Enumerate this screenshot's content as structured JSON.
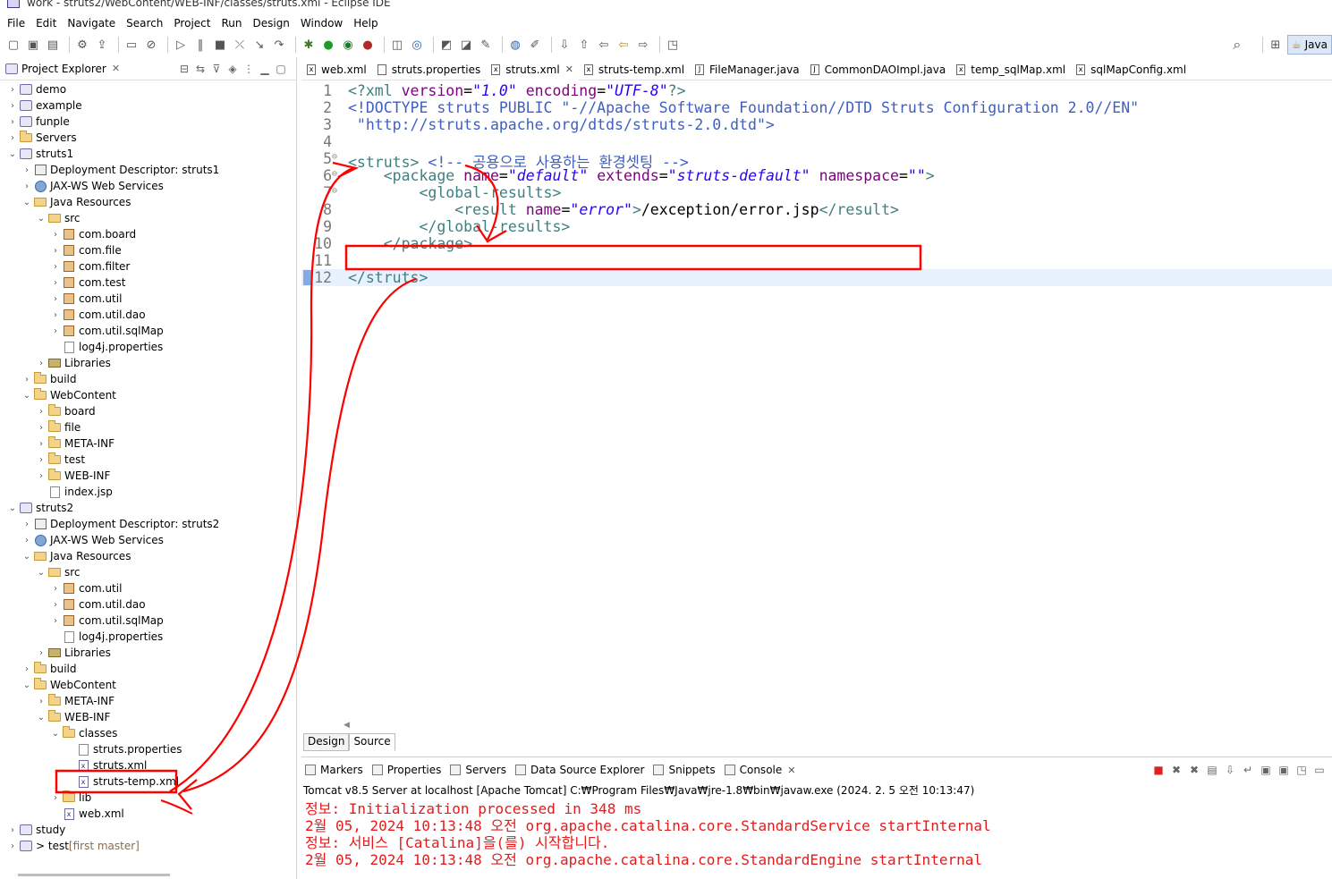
{
  "window": {
    "title": "work - struts2/WebContent/WEB-INF/classes/struts.xml - Eclipse IDE"
  },
  "menu": [
    "File",
    "Edit",
    "Navigate",
    "Search",
    "Project",
    "Run",
    "Design",
    "Window",
    "Help"
  ],
  "toolbar": {
    "perspective_label": "Java"
  },
  "explorer": {
    "title": "Project Explorer",
    "tree": [
      {
        "label": "demo",
        "depth": 0,
        "twisty": "›",
        "icon": "project"
      },
      {
        "label": "example",
        "depth": 0,
        "twisty": "›",
        "icon": "project"
      },
      {
        "label": "funple",
        "depth": 0,
        "twisty": "›",
        "icon": "project"
      },
      {
        "label": "Servers",
        "depth": 0,
        "twisty": "›",
        "icon": "folder"
      },
      {
        "label": "struts1",
        "depth": 0,
        "twisty": "⌄",
        "icon": "project"
      },
      {
        "label": "Deployment Descriptor: struts1",
        "depth": 1,
        "twisty": "›",
        "icon": "desc"
      },
      {
        "label": "JAX-WS Web Services",
        "depth": 1,
        "twisty": "›",
        "icon": "globe"
      },
      {
        "label": "Java Resources",
        "depth": 1,
        "twisty": "⌄",
        "icon": "src"
      },
      {
        "label": "src",
        "depth": 2,
        "twisty": "⌄",
        "icon": "src"
      },
      {
        "label": "com.board",
        "depth": 3,
        "twisty": "›",
        "icon": "package"
      },
      {
        "label": "com.file",
        "depth": 3,
        "twisty": "›",
        "icon": "package"
      },
      {
        "label": "com.filter",
        "depth": 3,
        "twisty": "›",
        "icon": "package"
      },
      {
        "label": "com.test",
        "depth": 3,
        "twisty": "›",
        "icon": "package"
      },
      {
        "label": "com.util",
        "depth": 3,
        "twisty": "›",
        "icon": "package"
      },
      {
        "label": "com.util.dao",
        "depth": 3,
        "twisty": "›",
        "icon": "package"
      },
      {
        "label": "com.util.sqlMap",
        "depth": 3,
        "twisty": "›",
        "icon": "package"
      },
      {
        "label": "log4j.properties",
        "depth": 3,
        "twisty": "",
        "icon": "file"
      },
      {
        "label": "Libraries",
        "depth": 2,
        "twisty": "›",
        "icon": "lib"
      },
      {
        "label": "build",
        "depth": 1,
        "twisty": "›",
        "icon": "folder"
      },
      {
        "label": "WebContent",
        "depth": 1,
        "twisty": "⌄",
        "icon": "folder"
      },
      {
        "label": "board",
        "depth": 2,
        "twisty": "›",
        "icon": "folder"
      },
      {
        "label": "file",
        "depth": 2,
        "twisty": "›",
        "icon": "folder"
      },
      {
        "label": "META-INF",
        "depth": 2,
        "twisty": "›",
        "icon": "folder"
      },
      {
        "label": "test",
        "depth": 2,
        "twisty": "›",
        "icon": "folder"
      },
      {
        "label": "WEB-INF",
        "depth": 2,
        "twisty": "›",
        "icon": "folder"
      },
      {
        "label": "index.jsp",
        "depth": 2,
        "twisty": "",
        "icon": "jsp"
      },
      {
        "label": "struts2",
        "depth": 0,
        "twisty": "⌄",
        "icon": "project"
      },
      {
        "label": "Deployment Descriptor: struts2",
        "depth": 1,
        "twisty": "›",
        "icon": "desc"
      },
      {
        "label": "JAX-WS Web Services",
        "depth": 1,
        "twisty": "›",
        "icon": "globe"
      },
      {
        "label": "Java Resources",
        "depth": 1,
        "twisty": "⌄",
        "icon": "src"
      },
      {
        "label": "src",
        "depth": 2,
        "twisty": "⌄",
        "icon": "src"
      },
      {
        "label": "com.util",
        "depth": 3,
        "twisty": "›",
        "icon": "package"
      },
      {
        "label": "com.util.dao",
        "depth": 3,
        "twisty": "›",
        "icon": "package"
      },
      {
        "label": "com.util.sqlMap",
        "depth": 3,
        "twisty": "›",
        "icon": "package"
      },
      {
        "label": "log4j.properties",
        "depth": 3,
        "twisty": "",
        "icon": "file"
      },
      {
        "label": "Libraries",
        "depth": 2,
        "twisty": "›",
        "icon": "lib"
      },
      {
        "label": "build",
        "depth": 1,
        "twisty": "›",
        "icon": "folder"
      },
      {
        "label": "WebContent",
        "depth": 1,
        "twisty": "⌄",
        "icon": "folder"
      },
      {
        "label": "META-INF",
        "depth": 2,
        "twisty": "›",
        "icon": "folder"
      },
      {
        "label": "WEB-INF",
        "depth": 2,
        "twisty": "⌄",
        "icon": "folder"
      },
      {
        "label": "classes",
        "depth": 3,
        "twisty": "⌄",
        "icon": "folder"
      },
      {
        "label": "struts.properties",
        "depth": 4,
        "twisty": "",
        "icon": "file"
      },
      {
        "label": "struts.xml",
        "depth": 4,
        "twisty": "",
        "icon": "xml"
      },
      {
        "label": "struts-temp.xml",
        "depth": 4,
        "twisty": "",
        "icon": "xml"
      },
      {
        "label": "lib",
        "depth": 3,
        "twisty": "›",
        "icon": "folder"
      },
      {
        "label": "web.xml",
        "depth": 3,
        "twisty": "",
        "icon": "xml"
      },
      {
        "label": "study",
        "depth": 0,
        "twisty": "›",
        "icon": "project"
      },
      {
        "label": "> test",
        "suffix": " [first master]",
        "depth": 0,
        "twisty": "›",
        "icon": "project"
      }
    ]
  },
  "editor_tabs": [
    {
      "label": "web.xml",
      "icon": "x"
    },
    {
      "label": "struts.properties",
      "icon": ""
    },
    {
      "label": "struts.xml",
      "icon": "x",
      "active": true
    },
    {
      "label": "struts-temp.xml",
      "icon": "x"
    },
    {
      "label": "FileManager.java",
      "icon": "J"
    },
    {
      "label": "CommonDAOImpl.java",
      "icon": "J"
    },
    {
      "label": "temp_sqlMap.xml",
      "icon": "x"
    },
    {
      "label": "sqlMapConfig.xml",
      "icon": "x"
    }
  ],
  "editor": {
    "lines": [
      {
        "n": "1",
        "fold": "",
        "tokens": [
          [
            "pi",
            "<?xml "
          ],
          [
            "attr",
            "version"
          ],
          [
            "txt",
            "="
          ],
          [
            "str",
            "\"1.0\""
          ],
          [
            "txt",
            " "
          ],
          [
            "attr",
            "encoding"
          ],
          [
            "txt",
            "="
          ],
          [
            "str",
            "\"UTF-8\""
          ],
          [
            "pi",
            "?>"
          ]
        ]
      },
      {
        "n": "2",
        "fold": "",
        "tokens": [
          [
            "doc",
            "<!DOCTYPE struts PUBLIC \"-//Apache Software Foundation//DTD Struts Configuration 2.0//EN\""
          ]
        ]
      },
      {
        "n": "3",
        "fold": "",
        "tokens": [
          [
            "doc",
            " \"http://struts.apache.org/dtds/struts-2.0.dtd\">"
          ]
        ]
      },
      {
        "n": "4",
        "fold": "",
        "tokens": []
      },
      {
        "n": "5",
        "fold": "⊖",
        "tokens": [
          [
            "tag",
            "<struts>"
          ],
          [
            "txt",
            " "
          ],
          [
            "cmt",
            "<!-- 공용으로 사용하는 환경셋팅 -->"
          ]
        ]
      },
      {
        "n": "6",
        "fold": "⊖",
        "tokens": [
          [
            "txt",
            "    "
          ],
          [
            "tag",
            "<package "
          ],
          [
            "attr",
            "name"
          ],
          [
            "txt",
            "="
          ],
          [
            "str",
            "\"default\""
          ],
          [
            "txt",
            " "
          ],
          [
            "attr",
            "extends"
          ],
          [
            "txt",
            "="
          ],
          [
            "str",
            "\"struts-default\""
          ],
          [
            "txt",
            " "
          ],
          [
            "attr",
            "namespace"
          ],
          [
            "txt",
            "="
          ],
          [
            "str",
            "\"\""
          ],
          [
            "tag",
            ">"
          ]
        ]
      },
      {
        "n": "7",
        "fold": "⊖",
        "tokens": [
          [
            "txt",
            "        "
          ],
          [
            "tag",
            "<global-results>"
          ]
        ]
      },
      {
        "n": "8",
        "fold": "",
        "tokens": [
          [
            "txt",
            "            "
          ],
          [
            "tag",
            "<result "
          ],
          [
            "attr",
            "name"
          ],
          [
            "txt",
            "="
          ],
          [
            "str",
            "\"error\""
          ],
          [
            "tag",
            ">"
          ],
          [
            "txt",
            "/exception/error.jsp"
          ],
          [
            "tag",
            "</result>"
          ]
        ]
      },
      {
        "n": "9",
        "fold": "",
        "tokens": [
          [
            "txt",
            "        "
          ],
          [
            "tag",
            "</global-results>"
          ]
        ]
      },
      {
        "n": "10",
        "fold": "",
        "tokens": [
          [
            "txt",
            "    "
          ],
          [
            "tag",
            "</package>"
          ]
        ]
      },
      {
        "n": "11",
        "fold": "",
        "tokens": []
      },
      {
        "n": "12",
        "fold": "",
        "current": true,
        "tokens": [
          [
            "tag",
            "</struts>"
          ]
        ]
      }
    ]
  },
  "design_source": {
    "design": "Design",
    "source": "Source"
  },
  "bottom": {
    "tabs": [
      {
        "label": "Markers"
      },
      {
        "label": "Properties"
      },
      {
        "label": "Servers"
      },
      {
        "label": "Data Source Explorer"
      },
      {
        "label": "Snippets"
      },
      {
        "label": "Console",
        "active": true
      }
    ],
    "console_desc": "Tomcat v8.5 Server at localhost [Apache Tomcat] C:₩Program Files₩Java₩jre-1.8₩bin₩javaw.exe  (2024. 2. 5 오전 10:13:47)",
    "console_lines": [
      "정보: Initialization processed in 348 ms",
      "2월 05, 2024 10:13:48 오전 org.apache.catalina.core.StandardService startInternal",
      "정보: 서비스 [Catalina]을(를) 시작합니다.",
      "2월 05, 2024 10:13:48 오전 org.apache.catalina.core.StandardEngine startInternal"
    ]
  },
  "colors": {
    "annotation": "#ff0000",
    "console_text": "#e31b1b",
    "selection": "#e8f2fe"
  }
}
